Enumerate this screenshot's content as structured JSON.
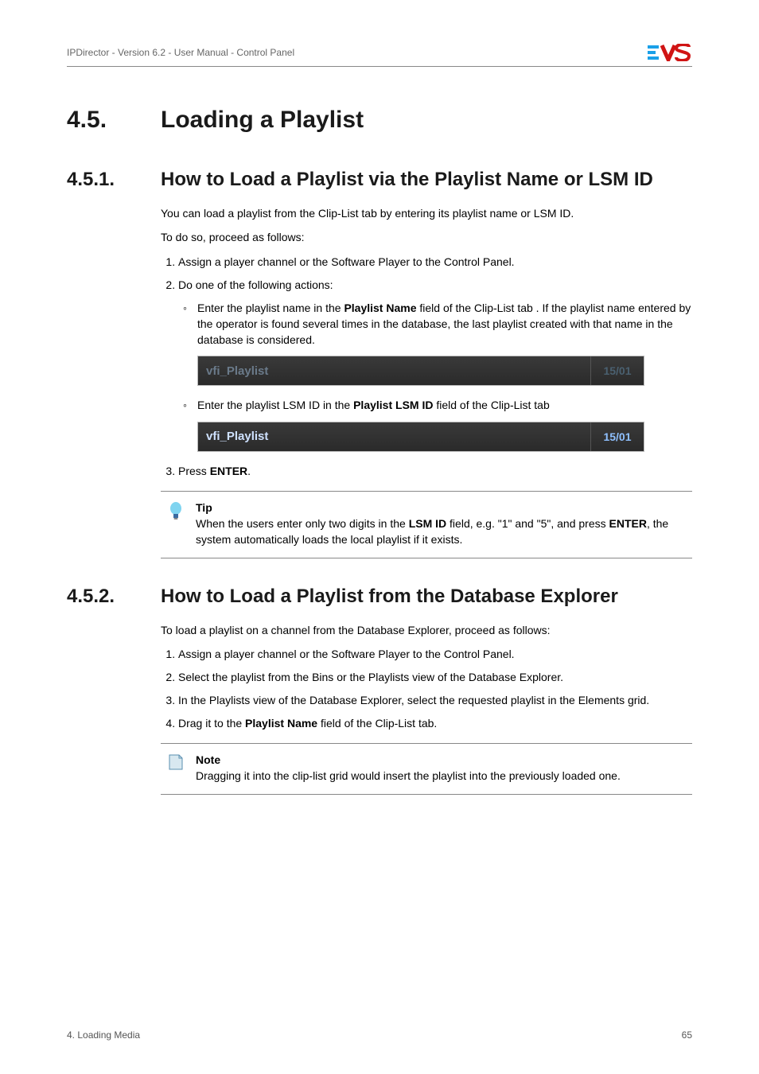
{
  "header": "IPDirector - Version 6.2 - User Manual - Control Panel",
  "h1": {
    "num": "4.5.",
    "text": "Loading a Playlist"
  },
  "s451": {
    "num": "4.5.1.",
    "title": "How to Load a Playlist via the Playlist Name or LSM ID",
    "p1": "You can load a playlist from the Clip-List tab by entering its playlist name or LSM ID.",
    "p2": "To do so, proceed as follows:",
    "step1": "Assign a player channel or the Software Player to the Control Panel.",
    "step2_lead": "Do one of the following actions:",
    "step2_a_pre": "Enter the playlist name in the ",
    "step2_a_bold": "Playlist Name",
    "step2_a_post": " field of the Clip-List tab . If the playlist name entered by the operator is found several times in the database, the last playlist created with that name in the database is considered.",
    "img1_main": "vfi_Playlist",
    "img1_side": "15/01",
    "step2_b_pre": "Enter the playlist LSM ID in the ",
    "step2_b_bold": "Playlist LSM ID",
    "step2_b_post": " field of the Clip-List tab",
    "img2_main": "vfi_Playlist",
    "img2_side": "15/01",
    "step3_pre": "Press ",
    "step3_bold": "ENTER",
    "step3_post": ".",
    "tip_title": "Tip",
    "tip_body_pre": "When the users enter only two digits in the ",
    "tip_body_b1": "LSM ID",
    "tip_body_mid": " field, e.g. \"1\" and \"5\", and press ",
    "tip_body_b2": "ENTER",
    "tip_body_post": ", the system automatically loads the local playlist if it exists."
  },
  "s452": {
    "num": "4.5.2.",
    "title": "How to Load a Playlist from the Database Explorer",
    "p1": "To load a playlist on a channel from the Database Explorer, proceed as follows:",
    "step1": "Assign a player channel or the Software Player to the Control Panel.",
    "step2": "Select the playlist from the Bins or the Playlists view of the Database Explorer.",
    "step3": "In the Playlists view of the Database Explorer, select the requested playlist in the Elements grid.",
    "step4_pre": "Drag it to the ",
    "step4_bold": "Playlist Name",
    "step4_post": " field of the Clip-List tab.",
    "note_title": "Note",
    "note_body": "Dragging it into the clip-list grid would insert the playlist into the previously loaded one."
  },
  "footer": {
    "left": "4. Loading Media",
    "right": "65"
  }
}
